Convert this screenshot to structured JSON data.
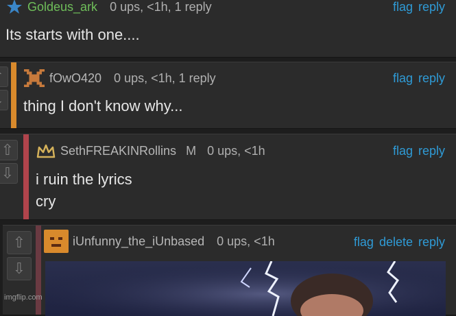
{
  "comments": [
    {
      "username": "Goldeus_ark",
      "meta": "0 ups, <1h, 1 reply",
      "text_lines": [
        "Its starts with one...."
      ],
      "actions": [
        "flag",
        "reply"
      ],
      "username_color": "#6fbf5a"
    },
    {
      "username": "fOwO420",
      "meta": "0 ups, <1h, 1 reply",
      "text_lines": [
        "thing I don't know why..."
      ],
      "actions": [
        "flag",
        "reply"
      ],
      "bar_color": "#d98a2c"
    },
    {
      "username": "SethFREAKINRollins",
      "mod_badge": "M",
      "meta": "0 ups, <1h",
      "text_lines": [
        "i ruin the lyrics",
        "cry"
      ],
      "actions": [
        "flag",
        "reply"
      ],
      "bar_color": "#b0444c"
    },
    {
      "username": "iUnfunny_the_iUnbased",
      "meta": "0 ups, <1h",
      "actions": [
        "flag",
        "delete",
        "reply"
      ],
      "bar_color": "#6a3a42"
    }
  ],
  "vote_icons": {
    "up": "up-arrow-icon",
    "down": "down-arrow-icon"
  },
  "watermark": "imgflip.com",
  "colors": {
    "link": "#2f9bd6",
    "background": "#1d1d1d",
    "panel": "#2b2b2b"
  }
}
